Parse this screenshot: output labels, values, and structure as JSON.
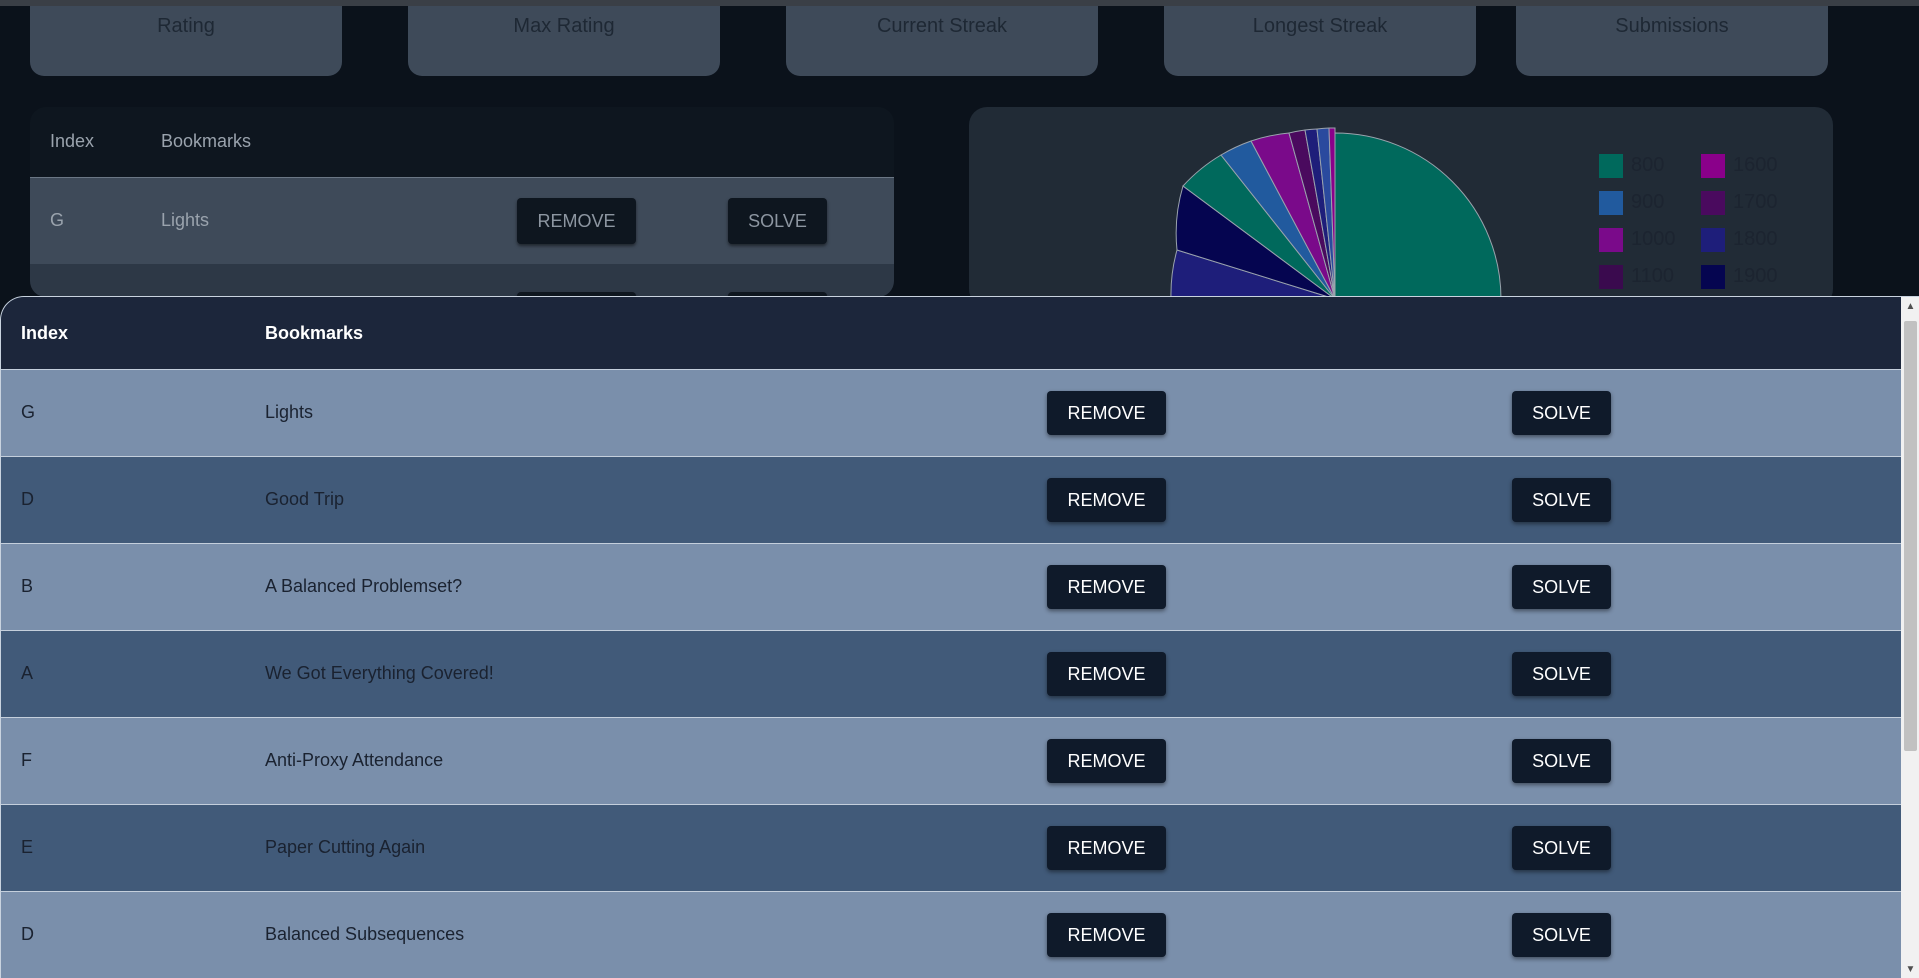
{
  "stats": [
    "Rating",
    "Max Rating",
    "Current Streak",
    "Longest Streak",
    "Submissions"
  ],
  "bg_table": {
    "headers": {
      "index": "Index",
      "bookmarks": "Bookmarks"
    },
    "row": {
      "index": "G",
      "name": "Lights",
      "remove": "REMOVE",
      "solve": "SOLVE"
    }
  },
  "chart_data": {
    "type": "pie",
    "legend": [
      {
        "label": "800",
        "color": "#00695c"
      },
      {
        "label": "1600",
        "color": "#8a008a"
      },
      {
        "label": "900",
        "color": "#215a9e"
      },
      {
        "label": "1700",
        "color": "#4a0a5e"
      },
      {
        "label": "1000",
        "color": "#7a0a8a"
      },
      {
        "label": "1800",
        "color": "#1e1e7a"
      },
      {
        "label": "1100",
        "color": "#3a0a4e"
      },
      {
        "label": "1900",
        "color": "#050550"
      }
    ]
  },
  "modal": {
    "headers": {
      "index": "Index",
      "bookmarks": "Bookmarks"
    },
    "rows": [
      {
        "index": "G",
        "name": "Lights",
        "remove": "REMOVE",
        "solve": "SOLVE"
      },
      {
        "index": "D",
        "name": "Good Trip",
        "remove": "REMOVE",
        "solve": "SOLVE"
      },
      {
        "index": "B",
        "name": "A Balanced Problemset?",
        "remove": "REMOVE",
        "solve": "SOLVE"
      },
      {
        "index": "A",
        "name": "We Got Everything Covered!",
        "remove": "REMOVE",
        "solve": "SOLVE"
      },
      {
        "index": "F",
        "name": "Anti-Proxy Attendance",
        "remove": "REMOVE",
        "solve": "SOLVE"
      },
      {
        "index": "E",
        "name": "Paper Cutting Again",
        "remove": "REMOVE",
        "solve": "SOLVE"
      },
      {
        "index": "D",
        "name": "Balanced Subsequences",
        "remove": "REMOVE",
        "solve": "SOLVE"
      }
    ]
  }
}
